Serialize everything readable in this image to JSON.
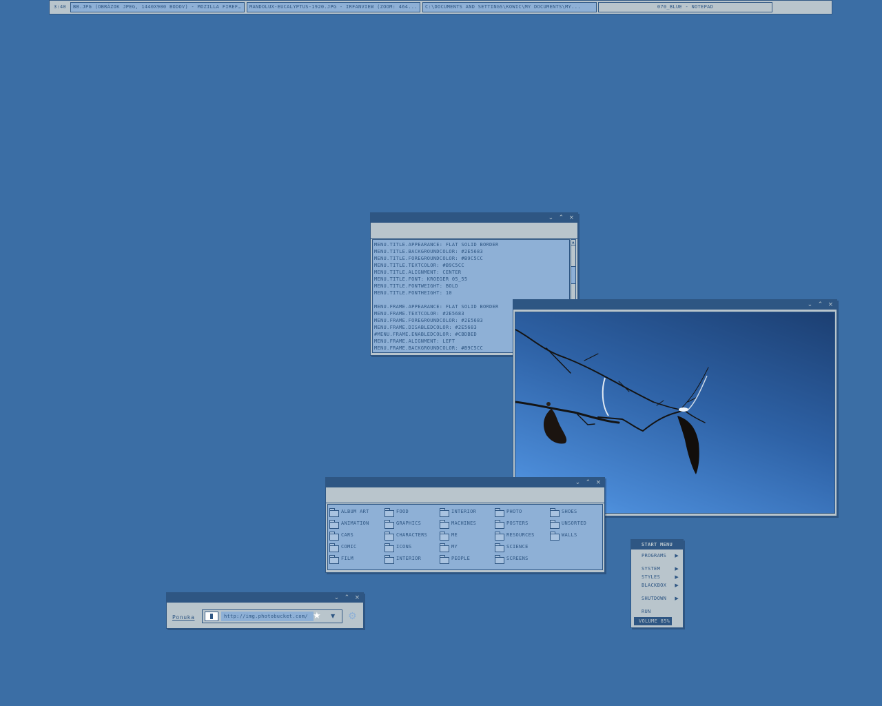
{
  "taskbar": {
    "clock": "3:40",
    "tasks": [
      {
        "label": "BB.JPG (OBRÁZOK JPEG, 1440X900 BODOV) - MOZILLA FIREF..."
      },
      {
        "label": "MANDOLUX-EUCALYPTUS-1920.JPG - IRFANVIEW (ZOOM: 464..."
      },
      {
        "label": "C:\\DOCUMENTS AND SETTINGS\\KOWIC\\MY DOCUMENTS\\MY..."
      },
      {
        "label": "070_BLUE - NOTEPAD"
      }
    ]
  },
  "notepad": {
    "lines": [
      "MENU.TITLE.APPEARANCE: FLAT SOLID BORDER",
      "MENU.TITLE.BACKGROUNDCOLOR: #2E5683",
      "MENU.TITLE.FOREGROUNDCOLOR: #B9C5CC",
      "MENU.TITLE.TEXTCOLOR: #B9C5CC",
      "MENU.TITLE.ALIGNMENT: CENTER",
      "MENU.TITLE.FONT: KROEGER 05_55",
      "MENU.TITLE.FONTWEIGHT: BOLD",
      "MENU.TITLE.FONTHEIGHT: 10",
      "",
      "MENU.FRAME.APPEARANCE: FLAT SOLID BORDER",
      "MENU.FRAME.TEXTCOLOR: #2E5683",
      "MENU.FRAME.FOREGROUNDCOLOR: #2E5683",
      "MENU.FRAME.DISABLEDCOLOR: #2E5683",
      "#MENU.FRAME.ENABLEDCOLOR: #CBDBED",
      "MENU.FRAME.ALIGNMENT: LEFT",
      "MENU.FRAME.BACKGROUNDCOLOR: #B9C5CC"
    ]
  },
  "folders": {
    "columns": [
      [
        "ALBUM ART",
        "ANIMATION",
        "CARS",
        "COMIC",
        "FILM"
      ],
      [
        "FOOD",
        "GRAPHICS",
        "CHARACTERS",
        "ICONS",
        "INTERIOR"
      ],
      [
        "INTERIOR",
        "MACHINES",
        "ME",
        "MY",
        "PEOPLE"
      ],
      [
        "PHOTO",
        "POSTERS",
        "RESOURCES",
        "SCIENCE",
        "SCREENS"
      ],
      [
        "SHOES",
        "UNSORTED",
        "WALLS"
      ]
    ]
  },
  "urlbar": {
    "label": "Ponuka",
    "url": "http://img.photobucket.com/"
  },
  "start_menu": {
    "title": "START MENU",
    "items": [
      {
        "label": "PROGRAMS",
        "submenu": true
      },
      {
        "label": "SYSTEM",
        "submenu": true
      },
      {
        "label": "STYLES",
        "submenu": true
      },
      {
        "label": "BLACKBOX",
        "submenu": true
      },
      {
        "label": "SHUTDOWN",
        "submenu": true
      },
      {
        "label": "RUN",
        "submenu": false
      },
      {
        "label": "VOLUME 85%",
        "submenu": false,
        "selected": true
      }
    ]
  },
  "icons": {
    "minimize": "chevron-down-icon",
    "maximize": "chevron-up-icon",
    "close": "close-icon",
    "folder": "folder-icon",
    "star": "star-icon",
    "dropdown": "triangle-down-icon",
    "go": "gear-icon"
  },
  "colors": {
    "desktop": "#3b6ea5",
    "frame": "#2e5683",
    "face": "#b9c5cc",
    "panel": "#8eb0d6"
  }
}
